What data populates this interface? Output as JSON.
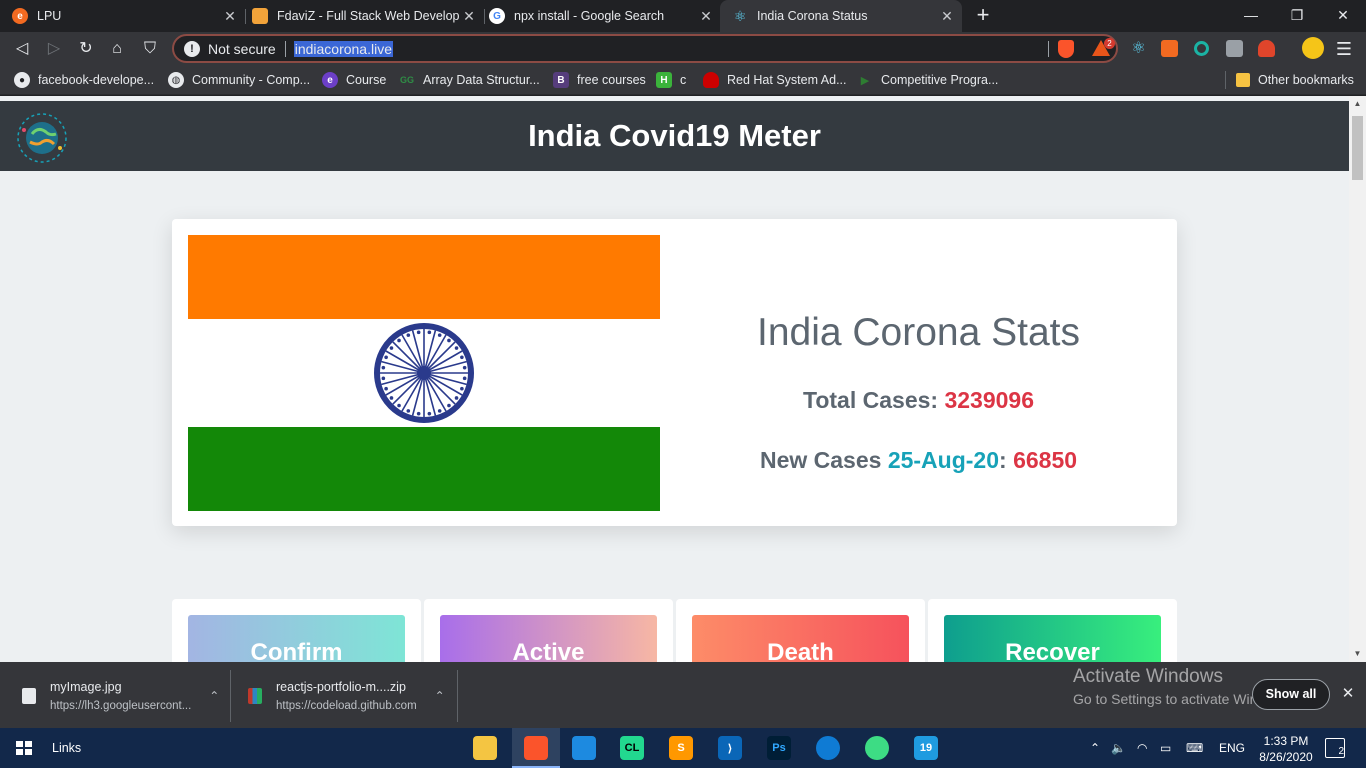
{
  "browser": {
    "tabs": [
      {
        "title": "LPU",
        "active": false,
        "favicon": "lpu-icon"
      },
      {
        "title": "FdaviZ - Full Stack Web Developer",
        "active": false,
        "favicon": "fdaviz-icon"
      },
      {
        "title": "npx install - Google Search",
        "active": false,
        "favicon": "google-icon"
      },
      {
        "title": "India Corona Status",
        "active": true,
        "favicon": "react-icon"
      }
    ],
    "new_tab": "+",
    "window_controls": {
      "minimize": "—",
      "maximize": "❐",
      "close": "✕"
    },
    "security_label": "Not secure",
    "url": "indiacorona.live",
    "brave_badge": "2"
  },
  "bookmarks": [
    {
      "label": "facebook-develope...",
      "icon": "github-icon",
      "color": "#e8eaed"
    },
    {
      "label": "Community - Comp...",
      "icon": "globe-icon",
      "color": "#e8eaed"
    },
    {
      "label": "Course",
      "icon": "edureka-icon",
      "color": "#6c3fc7"
    },
    {
      "label": "Array Data Structur...",
      "icon": "gfg-icon",
      "color": "#2f8d46"
    },
    {
      "label": "free courses",
      "icon": "bootstrap-icon",
      "color": "#563d7c"
    },
    {
      "label": "c",
      "icon": "hackerrank-icon",
      "color": "#3bb33b"
    },
    {
      "label": "Red Hat System Ad...",
      "icon": "redhat-icon",
      "color": "#cc0000"
    },
    {
      "label": "Competitive Progra...",
      "icon": "play-icon",
      "color": "#2e7d32"
    }
  ],
  "other_bookmarks": "Other bookmarks",
  "page": {
    "header_title": "India Covid19 Meter",
    "stats_title": "India Corona Stats",
    "total_label": "Total Cases: ",
    "total_value": "3239096",
    "new_label": "New Cases ",
    "new_date": "25-Aug-20",
    "new_sep": ": ",
    "new_value": "66850",
    "tiles": [
      {
        "label": "Confirm",
        "gradient": [
          "#a3b5e3",
          "#7ee5d6"
        ]
      },
      {
        "label": "Active",
        "gradient": [
          "#a86eea",
          "#f7b7a4"
        ]
      },
      {
        "label": "Death",
        "gradient": [
          "#fd8c68",
          "#f6525c"
        ]
      },
      {
        "label": "Recover",
        "gradient": [
          "#0e9e8e",
          "#38ef7d"
        ]
      }
    ],
    "flag_colors": {
      "saffron": "#ff7a00",
      "white": "#ffffff",
      "green": "#138808",
      "chakra": "#2a3a8c"
    }
  },
  "downloads": [
    {
      "name": "myImage.jpg",
      "source": "https://lh3.googleusercont...",
      "icon": "image-file-icon"
    },
    {
      "name": "reactjs-portfolio-m....zip",
      "source": "https://codeload.github.com",
      "icon": "zip-file-icon"
    }
  ],
  "show_all": "Show all",
  "watermark": {
    "line1": "Activate Windows",
    "line2": "Go to Settings to activate Windows."
  },
  "taskbar": {
    "links_label": "Links",
    "language": "ENG",
    "time": "1:33 PM",
    "date": "8/26/2020",
    "notifications": "2"
  }
}
